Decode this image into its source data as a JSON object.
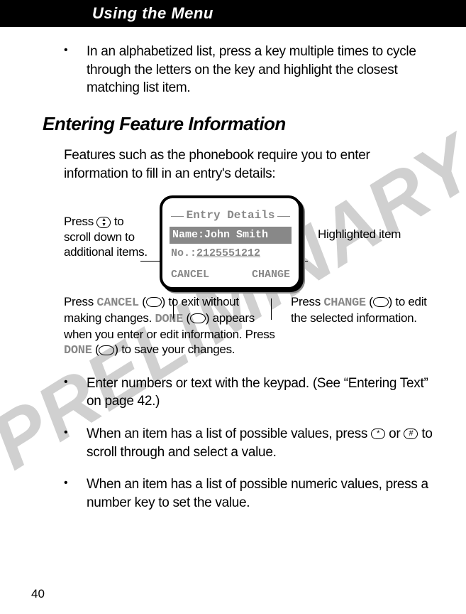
{
  "header": {
    "title": "Using the Menu"
  },
  "bullets_top": [
    "In an alphabetized list, press a key multiple times to cycle through the letters on the key and highlight the closest matching list item."
  ],
  "section": {
    "heading": "Entering Feature Information"
  },
  "intro": "Features such as the phonebook require you to enter information to fill in an entry's details:",
  "figure": {
    "left_caption_a": "Press ",
    "left_caption_b": " to scroll down to additional items.",
    "right_caption": "Highlighted item",
    "screen": {
      "title": "Entry Details",
      "name_label": "Name:",
      "name_value": "John Smith",
      "no_label": "No.:",
      "no_value": "2125551212",
      "soft_left": "CANCEL",
      "soft_right": "CHANGE"
    },
    "cancel_caption": {
      "p1a": "Press ",
      "p1b": "CANCEL",
      "p1c": " (",
      "p1d": ") to exit without making changes. ",
      "p2a": "DONE",
      "p2b": " (",
      "p2c": ") appears when you enter or edit information. Press ",
      "p3a": "DONE",
      "p3b": " (",
      "p3c": ") to save your changes."
    },
    "change_caption": {
      "a": "Press ",
      "b": "CHANGE",
      "c": " (",
      "d": ") to edit the selected information."
    }
  },
  "bullets_bottom": [
    "Enter numbers or text with the keypad. (See “Entering Text” on page 42.)",
    "When an item has a list of possible values, press * or # to scroll through and select a value.",
    "When an item has a list of possible numeric values, press a number key to set the value."
  ],
  "watermark": "PRELIMINARY",
  "page_number": "40"
}
